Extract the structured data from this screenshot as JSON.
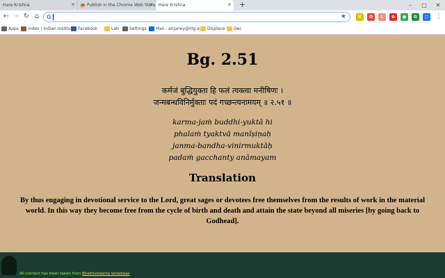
{
  "browser": {
    "tabs": [
      {
        "label": "Hare Krishna",
        "active": false
      },
      {
        "label": "Publish in the Chrome Web Store",
        "active": false
      },
      {
        "label": "Hare Krishna",
        "active": true
      }
    ],
    "new_tab_glyph": "+",
    "window_controls": [
      "–",
      "▢",
      "✕"
    ],
    "omnibox": {
      "value": "",
      "placeholder": ""
    },
    "bookmarks": [
      {
        "label": "Apps",
        "icon": "apps-grid-icon"
      },
      {
        "label": "index | Indian Institut",
        "icon": "site-icon"
      },
      {
        "label": "Facebook",
        "icon": "facebook-icon"
      },
      {
        "label": "Lab",
        "icon": "folder-icon"
      },
      {
        "label": "Settings",
        "icon": "gear-icon"
      },
      {
        "label": "Mail - anjaney@iitg.e",
        "icon": "outlook-icon"
      },
      {
        "label": "Displace",
        "icon": "folder-icon"
      },
      {
        "label": "Dec",
        "icon": "folder-icon"
      }
    ],
    "extensions": [
      {
        "glyph": "V",
        "color": "#e6b800"
      },
      {
        "glyph": "O",
        "color": "#ea4335"
      },
      {
        "glyph": "L",
        "color": "#f28b82"
      },
      {
        "glyph": "✿",
        "color": "#d93025"
      },
      {
        "glyph": "●",
        "color": "#34a853"
      },
      {
        "glyph": "G",
        "color": "#1e8e3e"
      },
      {
        "glyph": "▢",
        "color": "#1a73e8"
      }
    ],
    "accent_color": "#1a73e8"
  },
  "page": {
    "background_color": "#d2b48c",
    "title": "Bg. 2.51",
    "devanagari": [
      "कर्मजं बुद्धियुक्ता हि फलं त्यक्त्वा मनीषिणः ।",
      "जन्मबन्धविनिर्मुक्ताः पदं गच्छन्त्यनामयम् ॥ २.५१ ॥"
    ],
    "transliteration": [
      "karma-jaṁ buddhi-yuktā hi",
      "phalaṁ tyaktvā manīṣiṇaḥ",
      "janma-bandha-vinirmuktāḥ",
      "padaṁ gacchanty anāmayam"
    ],
    "translation_heading": "Translation",
    "translation_text": "By thus engaging in devotional service to the Lord, great sages or devotees free themselves from the results of work in the material world. In this way they become free from the cycle of birth and death and attain the state beyond all miseries [by going back to Godhead]."
  },
  "footer": {
    "note_prefix": "All content has been taken from ",
    "note_link": "Bhaktivedanta Vedabase",
    "background_color": "#1e3d32"
  }
}
